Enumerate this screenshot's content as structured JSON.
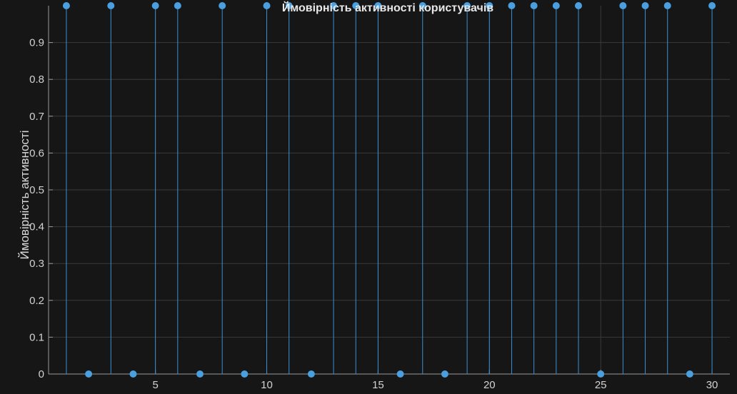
{
  "chart_data": {
    "type": "stem",
    "title": "Ймовірність активності користувачів",
    "xlabel": "",
    "ylabel": "Ймовірність активності",
    "xlim": [
      0.2,
      30.8
    ],
    "ylim": [
      0,
      1
    ],
    "x_ticks": [
      5,
      10,
      15,
      20,
      25,
      30
    ],
    "y_ticks": [
      0,
      0.1,
      0.2,
      0.3,
      0.4,
      0.5,
      0.6,
      0.7,
      0.8,
      0.9
    ],
    "grid": true,
    "colors": {
      "background": "#161616",
      "grid": "#3a3a3a",
      "axis": "#9a9a9a",
      "stem": "#3a8fd6",
      "marker": "#4a9fe0"
    },
    "x": [
      1,
      2,
      3,
      4,
      5,
      6,
      7,
      8,
      9,
      10,
      11,
      12,
      13,
      14,
      15,
      16,
      17,
      18,
      19,
      20,
      21,
      22,
      23,
      24,
      25,
      26,
      27,
      28,
      29,
      30
    ],
    "values": [
      1,
      0,
      1,
      0,
      1,
      1,
      0,
      1,
      0,
      1,
      1,
      0,
      1,
      1,
      1,
      0,
      1,
      0,
      1,
      1,
      1,
      1,
      1,
      1,
      0,
      1,
      1,
      1,
      0,
      1
    ]
  }
}
